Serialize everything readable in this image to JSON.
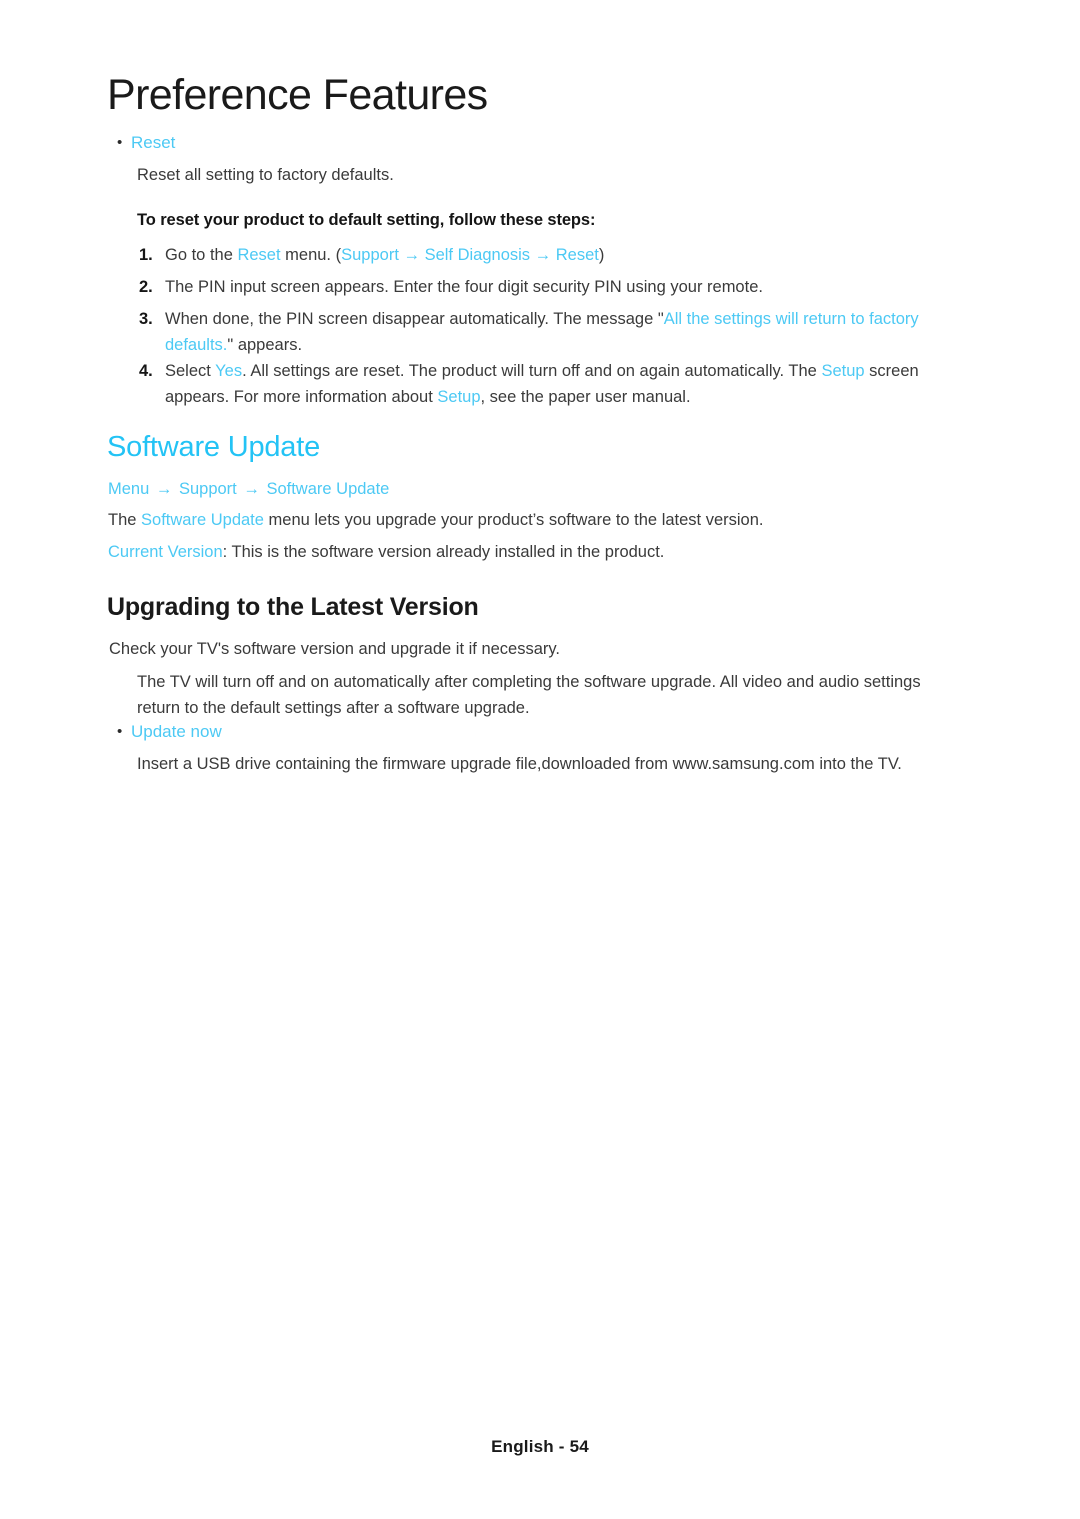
{
  "document": {
    "chapter_title": "Preference Features",
    "footer": "English - 54"
  },
  "reset_section": {
    "bullet_label": "Reset",
    "bullet_glyph": "•",
    "description": "Reset all setting to factory defaults.",
    "steps_intro": "To reset your product to default setting, follow these steps:",
    "steps": [
      {
        "number": "1.",
        "parts": [
          {
            "text": "Go to the ",
            "color": "dark"
          },
          {
            "text": "Reset",
            "color": "cyan"
          },
          {
            "text": " menu. (",
            "color": "dark"
          },
          {
            "text": "Support",
            "color": "cyan"
          },
          {
            "text": " → ",
            "color": "cyan"
          },
          {
            "text": "Self Diagnosis",
            "color": "cyan"
          },
          {
            "text": " → ",
            "color": "cyan"
          },
          {
            "text": "Reset",
            "color": "cyan"
          },
          {
            "text": ")",
            "color": "dark"
          }
        ]
      },
      {
        "number": "2.",
        "parts": [
          {
            "text": "The PIN input screen appears. Enter the four digit security PIN using your remote.",
            "color": "dark"
          }
        ]
      },
      {
        "number": "3.",
        "parts": [
          {
            "text": "When done, the PIN screen disappear automatically. The message \"",
            "color": "dark"
          },
          {
            "text": "All the settings will return to factory defaults.",
            "color": "cyan"
          },
          {
            "text": "\" appears.",
            "color": "dark"
          }
        ]
      },
      {
        "number": "4.",
        "parts": [
          {
            "text": "Select ",
            "color": "dark"
          },
          {
            "text": "Yes",
            "color": "cyan"
          },
          {
            "text": ". All settings are reset. The product will turn off and on again automatically. The ",
            "color": "dark"
          },
          {
            "text": "Setup",
            "color": "cyan"
          },
          {
            "text": " screen appears. For more information about ",
            "color": "dark"
          },
          {
            "text": "Setup",
            "color": "cyan"
          },
          {
            "text": ", see the paper user manual.",
            "color": "dark"
          }
        ]
      }
    ]
  },
  "software_update_section": {
    "heading": "Software Update",
    "breadcrumb": [
      {
        "text": "Menu"
      },
      {
        "text": "Support"
      },
      {
        "text": "Software Update"
      }
    ],
    "breadcrumb_arrow": "→",
    "intro_parts": [
      {
        "text": "The ",
        "color": "dark"
      },
      {
        "text": "Software Update",
        "color": "cyan"
      },
      {
        "text": " menu lets you upgrade your product’s software to the latest version.",
        "color": "dark"
      }
    ],
    "current_version_parts": [
      {
        "text": "Current Version",
        "color": "cyan"
      },
      {
        "text": ": This is the software version already installed in the product.",
        "color": "dark"
      }
    ]
  },
  "upgrading_section": {
    "heading": "Upgrading to the Latest Version",
    "intro": "Check your TV's software version and upgrade it if necessary.",
    "note": "The TV will turn off and on automatically after completing the software upgrade. All video and audio settings return to the default settings after a software upgrade.",
    "bullet_glyph": "•",
    "bullet_label": "Update now",
    "bullet_description": "Insert a USB drive containing the firmware upgrade file,downloaded from www.samsung.com into the TV."
  },
  "colors": {
    "accent_cyan": "#4cc9f4",
    "heading_cyan": "#23c3f5",
    "body_text": "#3a3a3a",
    "heading_dark": "#1a1a1a",
    "page_background": "#ffffff"
  }
}
